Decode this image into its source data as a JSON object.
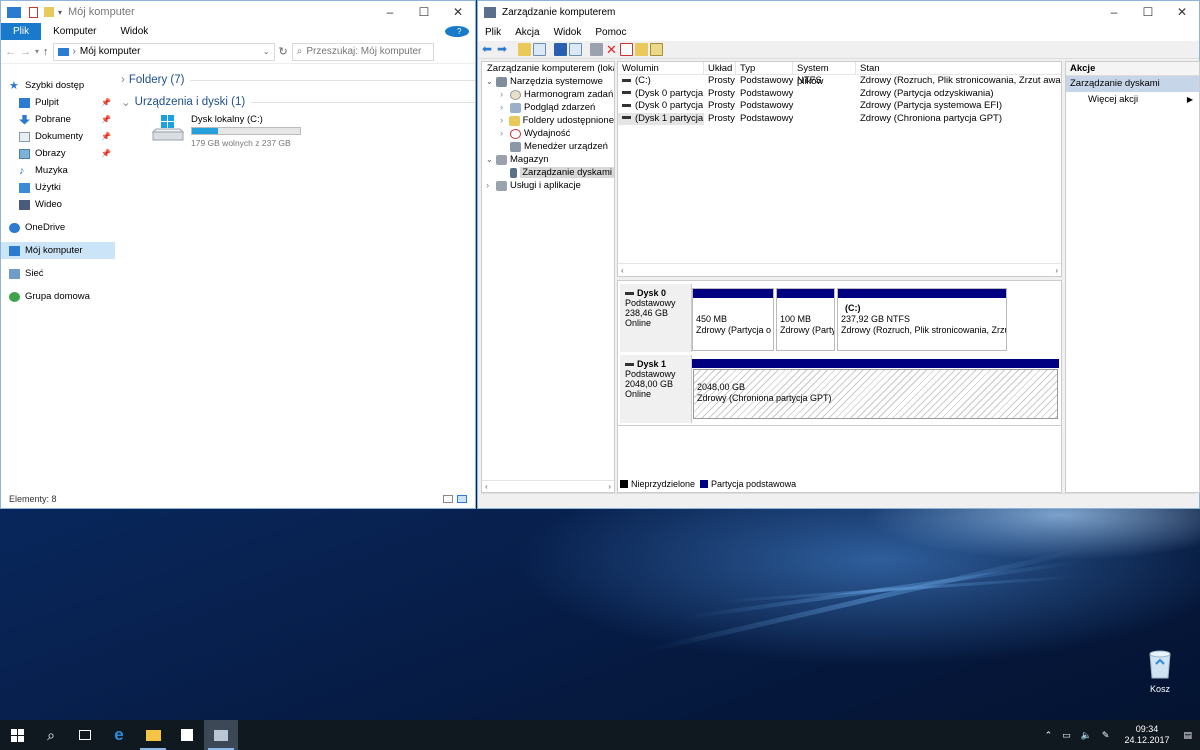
{
  "explorer": {
    "title": "Mój komputer",
    "ribbon_tabs": [
      "Plik",
      "Komputer",
      "Widok"
    ],
    "address": "Mój komputer",
    "search_placeholder": "Przeszukaj: Mój komputer",
    "nav": {
      "quick_access": "Szybki dostęp",
      "items": [
        {
          "label": "Pulpit",
          "icon": "desktop-icon",
          "pinned": true
        },
        {
          "label": "Pobrane",
          "icon": "download-icon",
          "pinned": true
        },
        {
          "label": "Dokumenty",
          "icon": "documents-icon",
          "pinned": true
        },
        {
          "label": "Obrazy",
          "icon": "pictures-icon",
          "pinned": true
        },
        {
          "label": "Muzyka",
          "icon": "music-icon",
          "pinned": false
        },
        {
          "label": "Użytki",
          "icon": "folder-icon",
          "pinned": false
        },
        {
          "label": "Wideo",
          "icon": "video-icon",
          "pinned": false
        }
      ],
      "onedrive": "OneDrive",
      "this_pc": "Mój komputer",
      "network": "Sieć",
      "homegroup": "Grupa domowa"
    },
    "groups": {
      "folders": "Foldery (7)",
      "devices": "Urządzenia i dyski (1)"
    },
    "drive": {
      "name": "Dysk lokalny (C:)",
      "free_text": "179 GB wolnych z 237 GB",
      "used_fraction": 0.245
    },
    "status": "Elementy: 8"
  },
  "mgmt": {
    "title": "Zarządzanie komputerem",
    "menu": [
      "Plik",
      "Akcja",
      "Widok",
      "Pomoc"
    ],
    "tree": {
      "root": "Zarządzanie komputerem (loka",
      "system_tools": "Narzędzia systemowe",
      "scheduler": "Harmonogram zadań",
      "event_viewer": "Podgląd zdarzeń",
      "shared_folders": "Foldery udostępnione",
      "performance": "Wydajność",
      "device_manager": "Menedżer urządzeń",
      "storage": "Magazyn",
      "disk_management": "Zarządzanie dyskami",
      "services": "Usługi i aplikacje"
    },
    "volumes": {
      "columns": [
        "Wolumin",
        "Układ",
        "Typ",
        "System plików",
        "Stan"
      ],
      "rows": [
        [
          "(C:)",
          "Prosty",
          "Podstawowy",
          "NTFS",
          "Zdrowy (Rozruch, Plik stronicowania, Zrzut awaryjny, Partycja podstawowa)"
        ],
        [
          "(Dysk 0 partycja 1)",
          "Prosty",
          "Podstawowy",
          "",
          "Zdrowy (Partycja odzyskiwania)"
        ],
        [
          "(Dysk 0 partycja 2)",
          "Prosty",
          "Podstawowy",
          "",
          "Zdrowy (Partycja systemowa EFI)"
        ],
        [
          "(Dysk 1 partycja 1)",
          "Prosty",
          "Podstawowy",
          "",
          "Zdrowy (Chroniona partycja GPT)"
        ]
      ]
    },
    "disk0": {
      "name": "Dysk 0",
      "type": "Podstawowy",
      "size": "238,46 GB",
      "state": "Online",
      "p1_size": "450 MB",
      "p1_state": "Zdrowy (Partycja o",
      "p2_size": "100 MB",
      "p2_state": "Zdrowy (Party",
      "p3_label": "(C:)",
      "p3_size": "237,92 GB NTFS",
      "p3_state": "Zdrowy (Rozruch, Plik stronicowania, Zrzu"
    },
    "disk1": {
      "name": "Dysk 1",
      "type": "Podstawowy",
      "size": "2048,00 GB",
      "state": "Online",
      "p1_size": "2048,00 GB",
      "p1_state": "Zdrowy (Chroniona partycja GPT)"
    },
    "legend": {
      "unallocated": "Nieprzydzielone",
      "primary": "Partycja podstawowa",
      "unallocated_color": "#000000",
      "primary_color": "#000080"
    },
    "actions": {
      "header": "Akcje",
      "section": "Zarządzanie dyskami",
      "more": "Więcej akcji"
    }
  },
  "desktop": {
    "recycle_bin": "Kosz"
  },
  "taskbar": {
    "time": "09:34",
    "date": "24.12.2017"
  }
}
